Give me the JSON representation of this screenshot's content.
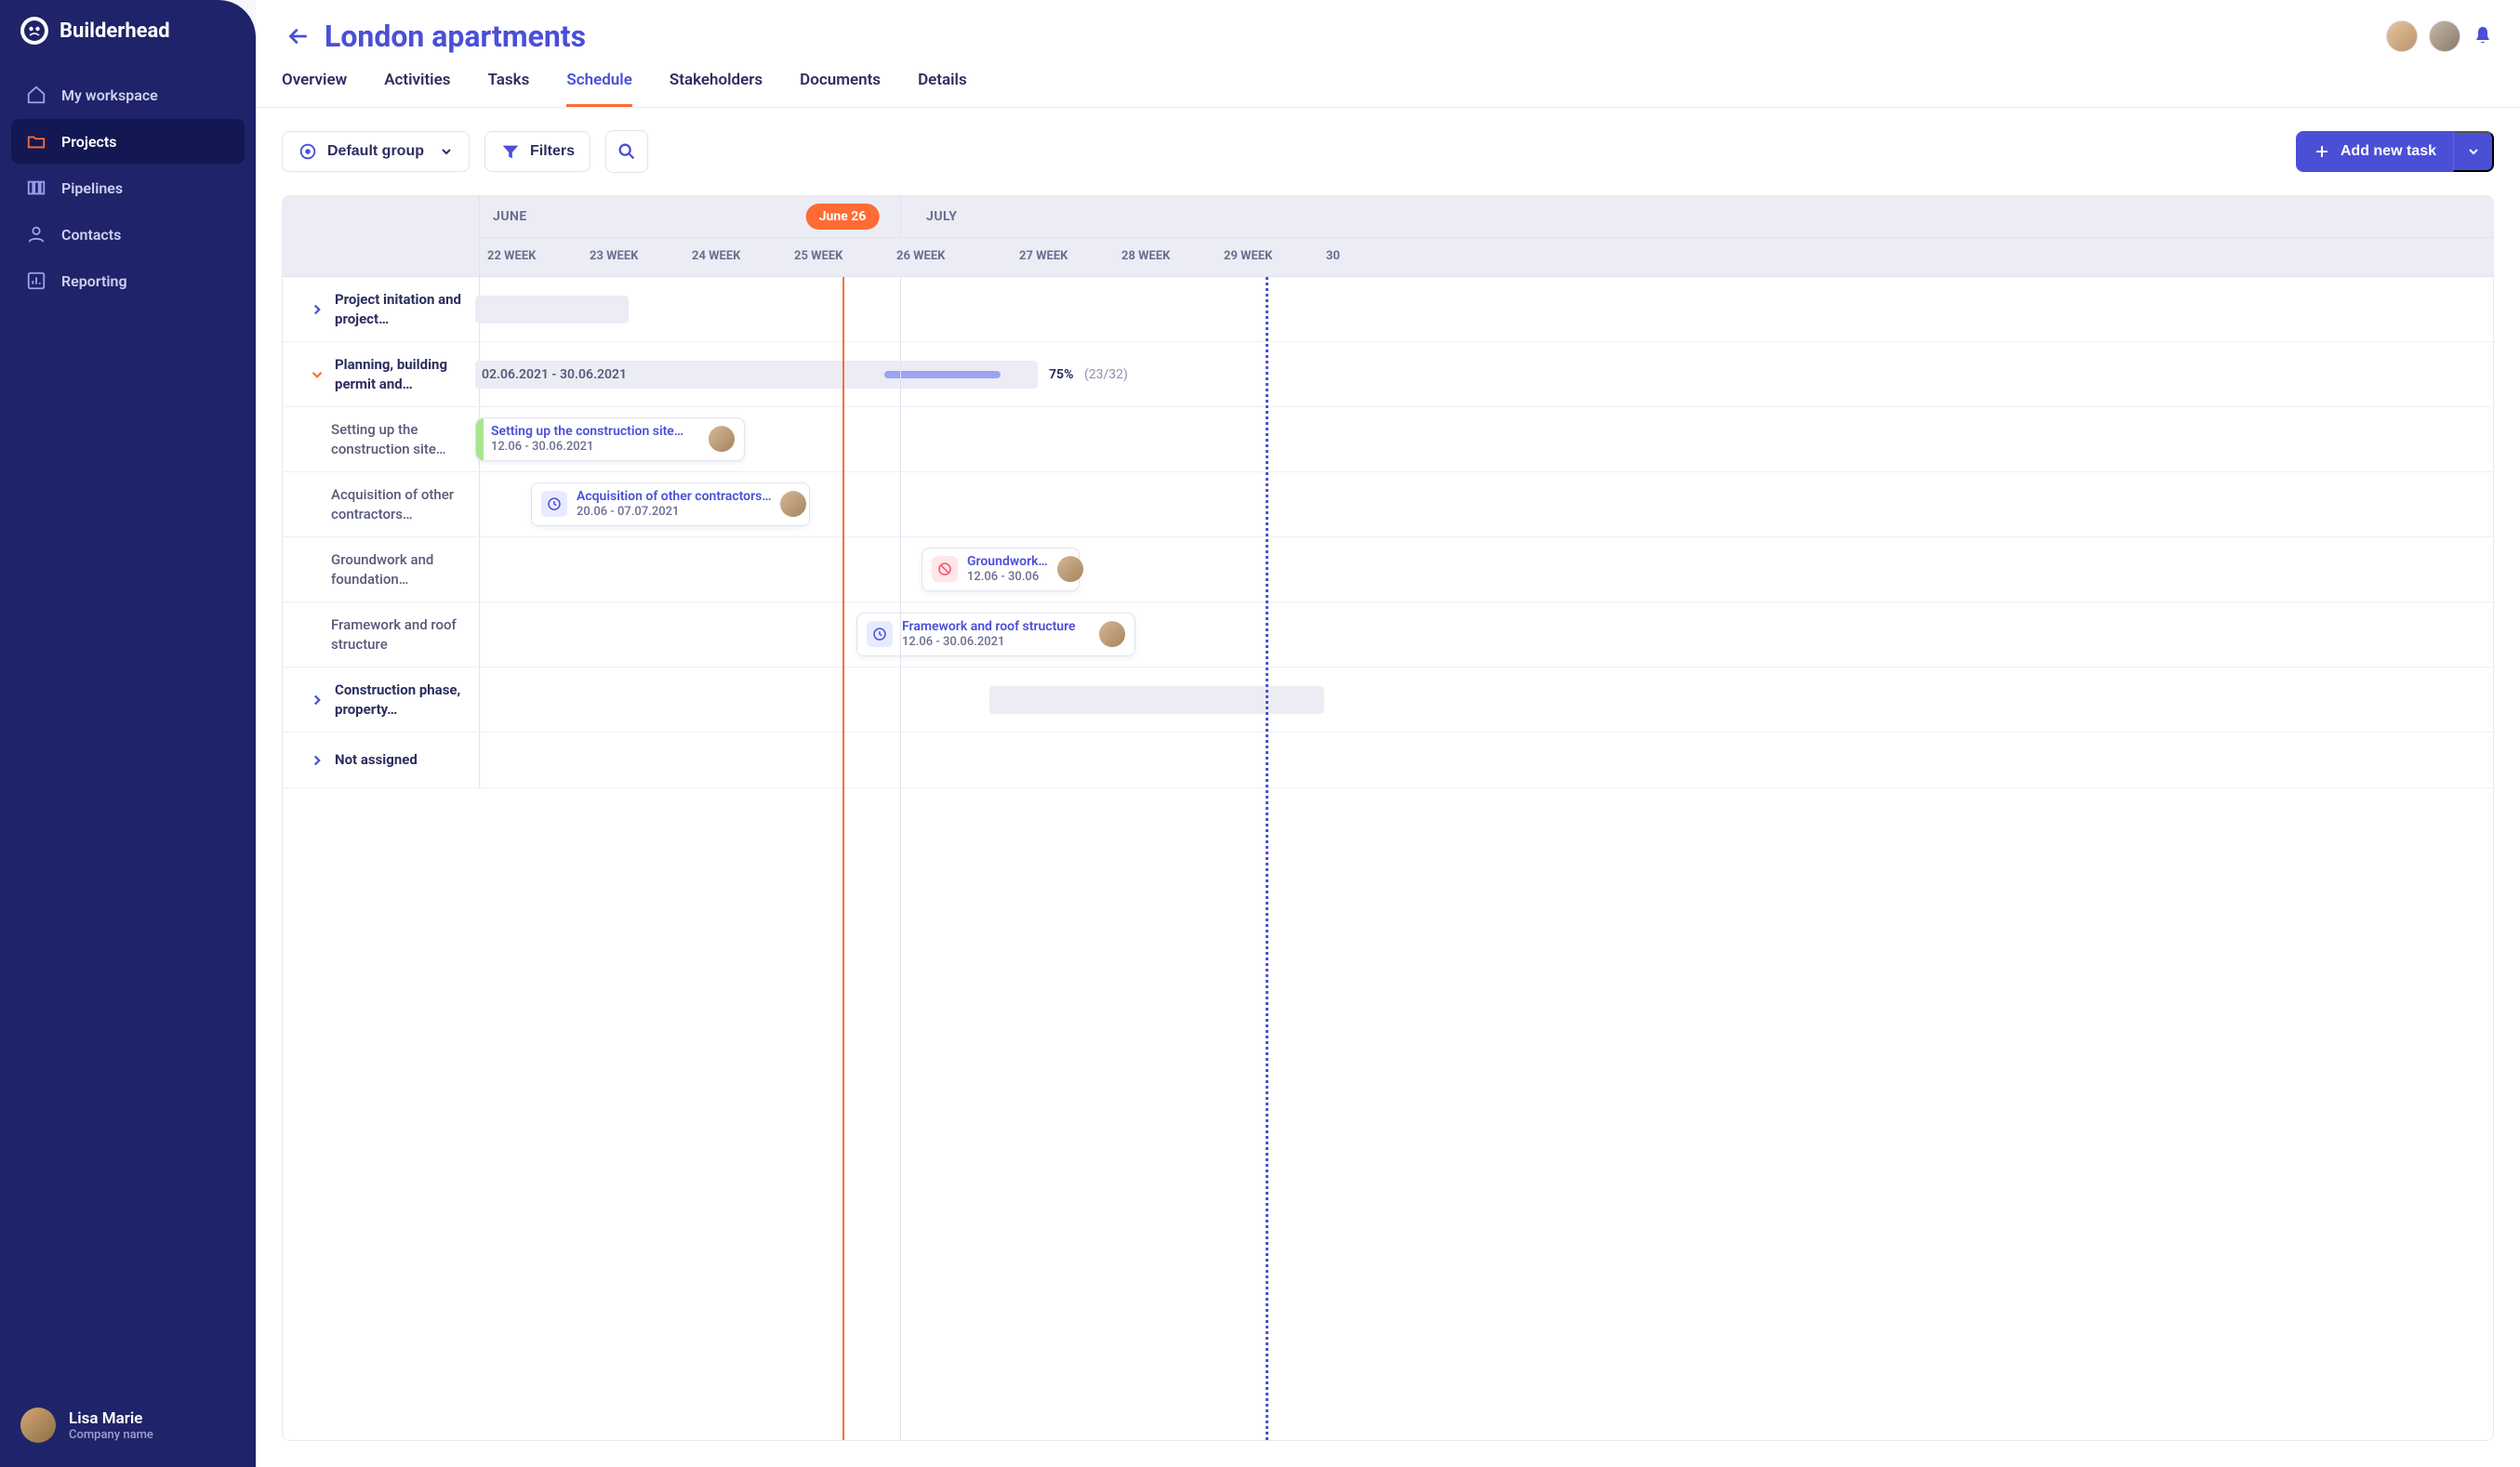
{
  "brand": "Builderhead",
  "sidebar": {
    "items": [
      {
        "label": "My workspace",
        "id": "workspace"
      },
      {
        "label": "Projects",
        "id": "projects"
      },
      {
        "label": "Pipelines",
        "id": "pipelines"
      },
      {
        "label": "Contacts",
        "id": "contacts"
      },
      {
        "label": "Reporting",
        "id": "reporting"
      }
    ],
    "user": {
      "name": "Lisa Marie",
      "company": "Company name"
    }
  },
  "header": {
    "title": "London apartments"
  },
  "tabs": [
    "Overview",
    "Activities",
    "Tasks",
    "Schedule",
    "Stakeholders",
    "Documents",
    "Details"
  ],
  "active_tab": "Schedule",
  "toolbar": {
    "group_label": "Default group",
    "filters_label": "Filters",
    "add_label": "Add new task"
  },
  "timeline": {
    "months": [
      "JUNE",
      "JULY"
    ],
    "weeks": [
      "22 WEEK",
      "23 WEEK",
      "24 WEEK",
      "25 WEEK",
      "26 WEEK",
      "27 WEEK",
      "28 WEEK",
      "29 WEEK",
      "30"
    ],
    "today_label": "June 26"
  },
  "rows": [
    {
      "label": "Project initation and project…",
      "type": "group"
    },
    {
      "label": "Planning, building permit and…",
      "type": "group-open",
      "summary": {
        "dates": "02.06.2021 - 30.06.2021",
        "percent": "75%",
        "count": "(23/32)"
      }
    },
    {
      "label": "Setting up the construction site…",
      "type": "task",
      "card": {
        "title": "Setting up the construction site…",
        "dates": "12.06 - 30.06.2021",
        "status": "done"
      }
    },
    {
      "label": "Acquisition of other contractors…",
      "type": "task",
      "card": {
        "title": "Acquisition of other contractors…",
        "dates": "20.06 - 07.07.2021",
        "status": "clock"
      }
    },
    {
      "label": "Groundwork and foundation…",
      "type": "task",
      "card": {
        "title": "Groundwork…",
        "dates": "12.06 - 30.06",
        "status": "blocked"
      }
    },
    {
      "label": "Framework and roof structure",
      "type": "task",
      "card": {
        "title": "Framework and roof structure",
        "dates": "12.06 - 30.06.2021",
        "status": "clock"
      }
    },
    {
      "label": "Construction phase, property…",
      "type": "group"
    },
    {
      "label": "Not assigned",
      "type": "group"
    }
  ]
}
